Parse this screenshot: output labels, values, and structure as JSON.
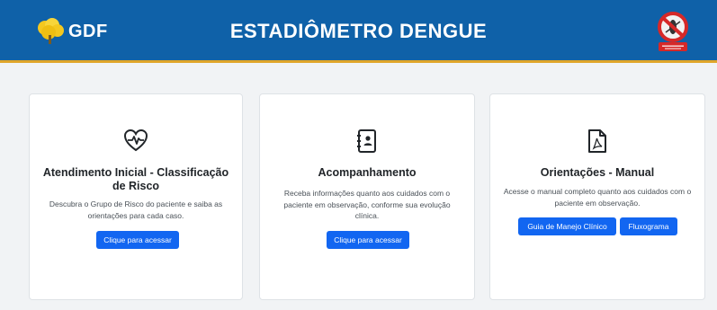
{
  "header": {
    "logo_text": "GDF",
    "title": "ESTADIÔMETRO DENGUE"
  },
  "cards": [
    {
      "title": "Atendimento Inicial - Classificação de Risco",
      "description": "Descubra o Grupo de Risco do paciente e saiba as orientações para cada caso.",
      "buttons": [
        "Clique para acessar"
      ]
    },
    {
      "title": "Acompanhamento",
      "description": "Receba informações quanto aos cuidados com o paciente em observação, conforme sua evolução clínica.",
      "buttons": [
        "Clique para acessar"
      ]
    },
    {
      "title": "Orientações - Manual",
      "description": "Acesse o manual completo quanto aos cuidados com o paciente em observação.",
      "buttons": [
        "Guia de Manejo Clínico",
        "Fluxograma"
      ]
    }
  ],
  "icons": [
    "heart-pulse-icon",
    "clipboard-person-icon",
    "pdf-file-icon"
  ],
  "colors": {
    "header_bg": "#0f61a8",
    "header_border": "#e0a52a",
    "button_bg": "#1266f1",
    "page_bg": "#f1f3f5"
  }
}
